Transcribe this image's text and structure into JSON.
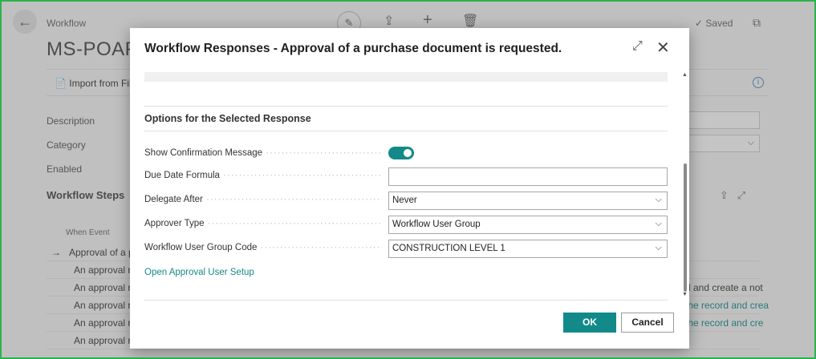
{
  "background": {
    "breadcrumb": "Workflow",
    "title": "MS-POAPY",
    "saved": "Saved",
    "import_action": "Import from File",
    "fields": [
      "Description",
      "Category",
      "Enabled"
    ],
    "section": "Workflow Steps",
    "column_when_event": "When Event",
    "rows": [
      {
        "text": "Approval of a p",
        "right": ""
      },
      {
        "text": "An approval re",
        "right": ""
      },
      {
        "text": "An approval re",
        "right": "d and create a not"
      },
      {
        "text": "An approval re",
        "right": "the record and crea"
      },
      {
        "text": "An approval re",
        "right": "the record and cre"
      },
      {
        "text": "An approval re",
        "right": ""
      }
    ]
  },
  "dialog": {
    "title": "Workflow Responses - Approval of a purchase document is requested.",
    "options_header": "Options for the Selected Response",
    "fields": {
      "show_confirmation": {
        "label": "Show Confirmation Message",
        "value": true
      },
      "due_date": {
        "label": "Due Date Formula",
        "value": ""
      },
      "delegate_after": {
        "label": "Delegate After",
        "value": "Never"
      },
      "approver_type": {
        "label": "Approver Type",
        "value": "Workflow User Group"
      },
      "group_code": {
        "label": "Workflow User Group Code",
        "value": "CONSTRUCTION LEVEL 1"
      }
    },
    "link": "Open Approval User Setup",
    "ok_label": "OK",
    "cancel_label": "Cancel"
  },
  "icons": {
    "back": "back-arrow-icon",
    "edit": "pencil-icon",
    "share": "share-icon",
    "add": "plus-icon",
    "delete": "trash-icon",
    "expand": "expand-icon",
    "close": "close-icon"
  },
  "colors": {
    "accent": "#138a8a",
    "frame": "#2db34a"
  }
}
